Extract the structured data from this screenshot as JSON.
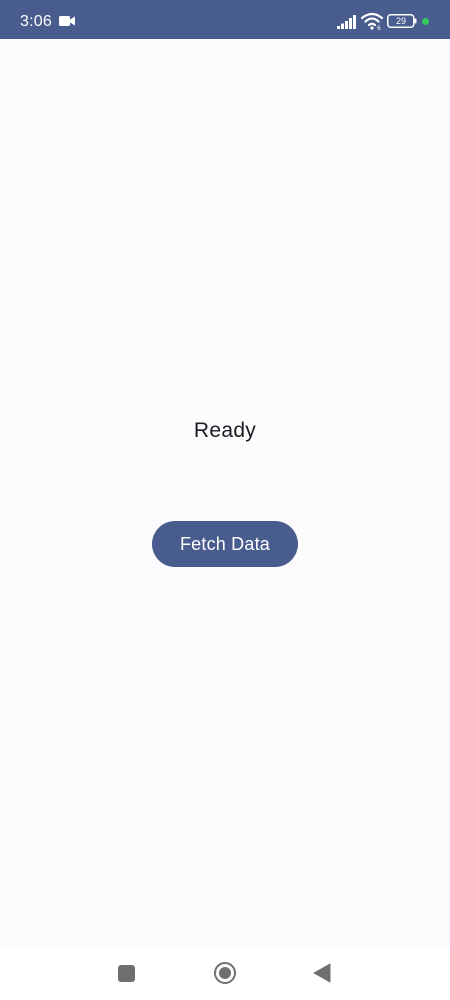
{
  "status_bar": {
    "time": "3:06",
    "battery_level": "29",
    "icons": [
      "video-camera-icon",
      "signal-icon",
      "wifi-icon",
      "battery-icon",
      "privacy-indicator-dot"
    ],
    "background_color": "#485c8e"
  },
  "main": {
    "status_text": "Ready",
    "fetch_button_label": "Fetch Data",
    "accent_color": "#485c8e"
  },
  "nav_bar": {
    "buttons": [
      "recents-button",
      "home-button",
      "back-button"
    ]
  }
}
